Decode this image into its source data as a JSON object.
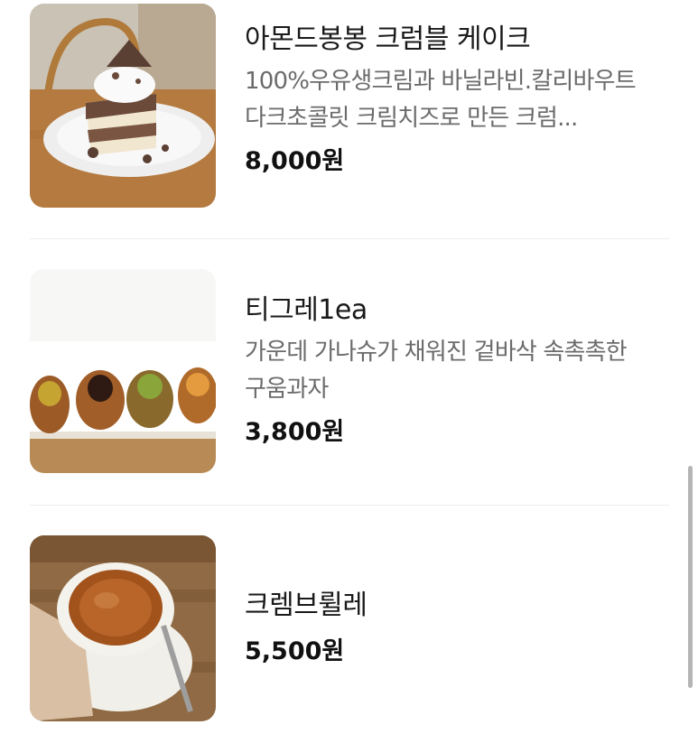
{
  "menu": {
    "items": [
      {
        "name": "아몬드봉봉 크럼블 케이크",
        "description": "100%우유생크림과 바닐라빈.칼리바우트 다크초콜릿 크림치즈로 만든 크럼...",
        "price": "8,000원",
        "image": "almond-crumble-cake-photo"
      },
      {
        "name": "티그레1ea",
        "description": "가운데 가나슈가 채워진 겉바삭 속촉촉한 구움과자",
        "price": "3,800원",
        "image": "tigre-pastry-photo"
      },
      {
        "name": "크렘브륄레",
        "description": "",
        "price": "5,500원",
        "image": "creme-brulee-photo"
      }
    ]
  }
}
